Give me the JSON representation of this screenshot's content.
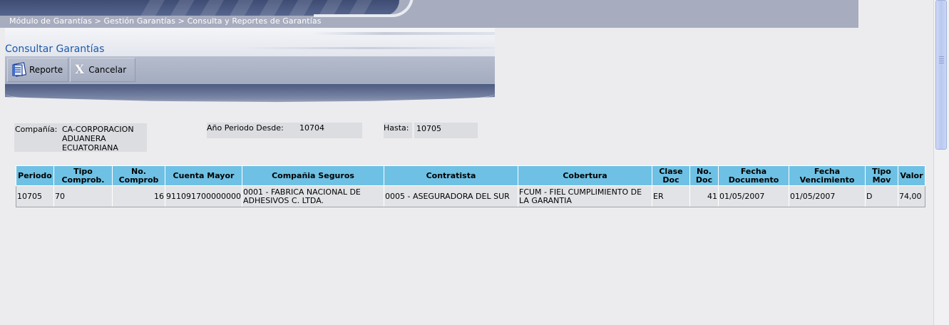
{
  "breadcrumb": "Módulo de Garantías > Gestión Garantías > Consulta y Reportes de Garantías",
  "page_title": "Consultar Garantías",
  "toolbar": {
    "reporte_label": "Reporte",
    "cancelar_label": "Cancelar",
    "reporte_icon": "report-icon",
    "cancelar_icon": "close-x-icon"
  },
  "filters": {
    "compania_label": "Compañía:",
    "compania_value": "CA-CORPORACION ADUANERA ECUATORIANA",
    "anio_label": "Año Periodo Desde:",
    "anio_value": "10704",
    "hasta_label": "Hasta:",
    "hasta_value": "10705"
  },
  "table": {
    "headers": [
      "Periodo",
      "Tipo Comprob.",
      "No. Comprob",
      "Cuenta Mayor",
      "Compañia Seguros",
      "Contratista",
      "Cobertura",
      "Clase Doc",
      "No. Doc",
      "Fecha Documento",
      "Fecha Vencimiento",
      "Tipo Mov",
      "Valor"
    ],
    "rows": [
      [
        "10705",
        "70",
        "16",
        "911091700000000",
        "0001 - FABRICA NACIONAL DE ADHESIVOS C. LTDA.",
        "0005 - ASEGURADORA DEL SUR",
        "FCUM - FIEL CUMPLIMIENTO DE LA GARANTIA",
        "ER",
        "41",
        "01/05/2007",
        "01/05/2007",
        "D",
        "74,00"
      ]
    ]
  },
  "colors": {
    "header_bg": "#6ec1e4",
    "title_color": "#1c5aa8",
    "banner": "#a7adbf"
  }
}
